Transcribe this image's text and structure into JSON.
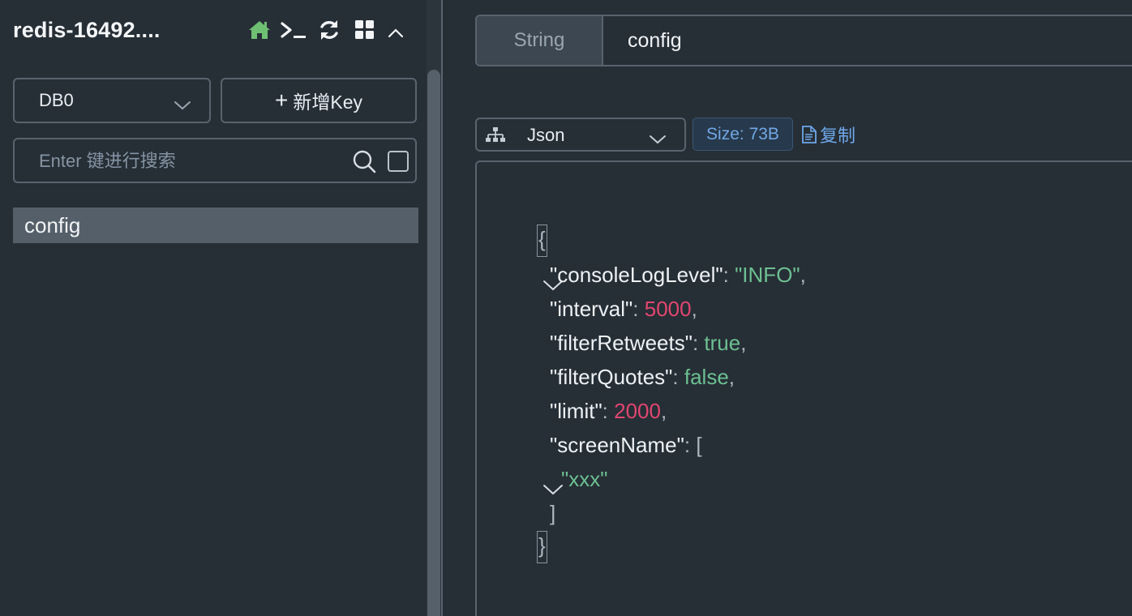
{
  "sidebar": {
    "connection_title": "redis-16492....",
    "toolbar_icons": [
      "home-icon",
      "terminal-icon",
      "refresh-icon",
      "grid-icon",
      "chevron-up-icon"
    ],
    "db_select": {
      "value": "DB0"
    },
    "add_key_button": {
      "plus": "+",
      "label": "新增Key"
    },
    "search": {
      "placeholder": "Enter 键进行搜索",
      "value": ""
    },
    "keys": [
      {
        "name": "config"
      }
    ]
  },
  "main": {
    "key_type": "String",
    "key_name": "config",
    "format_select": {
      "value": "Json"
    },
    "size_badge": "Size: 73B",
    "copy_button": "复制",
    "json_lines": {
      "open_brace": "{",
      "l1": {
        "key": "\"consoleLogLevel\"",
        "colon": ": ",
        "value": "\"INFO\"",
        "comma": ","
      },
      "l2": {
        "key": "\"interval\"",
        "colon": ": ",
        "value": "5000",
        "comma": ","
      },
      "l3": {
        "key": "\"filterRetweets\"",
        "colon": ": ",
        "value": "true",
        "comma": ","
      },
      "l4": {
        "key": "\"filterQuotes\"",
        "colon": ": ",
        "value": "false",
        "comma": ","
      },
      "l5": {
        "key": "\"limit\"",
        "colon": ": ",
        "value": "2000",
        "comma": ","
      },
      "l6": {
        "key": "\"screenName\"",
        "colon": ": ",
        "value": "["
      },
      "l7": {
        "value": "\"xxx\""
      },
      "close_bracket": "]",
      "close_brace": "}"
    }
  },
  "colors": {
    "background": "#262e36",
    "border": "#59636e",
    "selected_item": "#545f69",
    "home_icon": "#6fbf73",
    "json_string": "#6cc091",
    "json_number": "#e2466f",
    "json_boolean": "#6cc091",
    "accent_blue": "#6ea8ea"
  }
}
